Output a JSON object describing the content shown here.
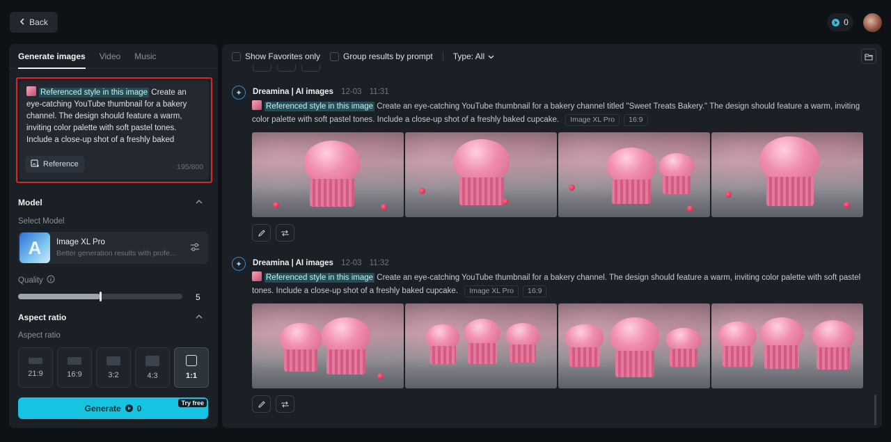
{
  "header": {
    "back_label": "Back",
    "credits": "0"
  },
  "sidebar": {
    "tabs": [
      {
        "label": "Generate images",
        "active": true
      },
      {
        "label": "Video"
      },
      {
        "label": "Music"
      }
    ],
    "prompt": {
      "ref_chip": "Referenced style in this image",
      "text": "Create an eye-catching YouTube thumbnail for a bakery channel. The design should feature a warm, inviting color palette with soft pastel tones. Include a close-up shot of a freshly baked",
      "reference_label": "Reference",
      "counter": "195/800"
    },
    "model_section": {
      "title": "Model",
      "select_label": "Select Model",
      "model_name": "Image XL Pro",
      "model_desc": "Better generation results with professional quality"
    },
    "quality": {
      "label": "Quality",
      "value": "5",
      "fraction": 0.5
    },
    "aspect_section": {
      "title": "Aspect ratio",
      "label": "Aspect ratio"
    },
    "ratios": [
      {
        "label": "21:9"
      },
      {
        "label": "16:9"
      },
      {
        "label": "3:2"
      },
      {
        "label": "4:3"
      },
      {
        "label": "1:1",
        "active": true
      }
    ],
    "generate": {
      "label": "Generate",
      "cost": "0",
      "badge": "Try free"
    }
  },
  "toolbar": {
    "favorites": "Show Favorites only",
    "group": "Group results by prompt",
    "type": "Type: All"
  },
  "groups": [
    {
      "source": "Dreamina | AI images",
      "date": "12-03",
      "time": "11:31",
      "ref_chip": "Referenced style in this image",
      "prompt": "Create an eye-catching YouTube thumbnail for a bakery channel titled \"Sweet Treats Bakery.\" The design should feature a warm, inviting color palette with soft pastel tones. Include a close-up shot of a freshly baked cupcake.",
      "model_tag": "Image XL Pro",
      "ratio_tag": "16:9"
    },
    {
      "source": "Dreamina | AI images",
      "date": "12-03",
      "time": "11:32",
      "ref_chip": "Referenced style in this image",
      "prompt": "Create an eye-catching YouTube thumbnail for a bakery channel. The design should feature a warm, inviting color palette with soft pastel tones. Include a close-up shot of a freshly baked cupcake.",
      "model_tag": "Image XL Pro",
      "ratio_tag": "16:9"
    }
  ],
  "colors": {
    "accent": "#16c3e0",
    "highlight_border": "#e02424",
    "chip_bg": "#224d55"
  }
}
